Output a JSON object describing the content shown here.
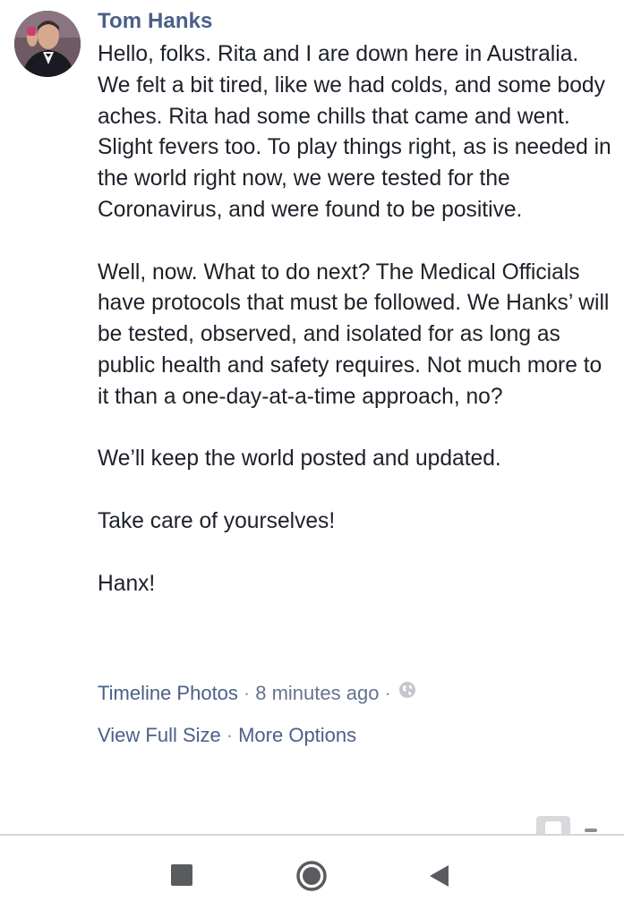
{
  "post": {
    "author": "Tom Hanks",
    "paragraphs": [
      "Hello, folks. Rita and I are down here in Australia. We felt a bit tired, like we had colds, and some body aches. Rita had some chills that came and went. Slight fevers too. To play things right, as is needed in the world right now, we were tested for the Coronavirus, and were found to be positive.",
      "Well, now. What to do next? The Medical Officials have protocols that must be followed. We Hanks’ will be tested, observed, and isolated for as long as public health and safety requires. Not much more to it than a one-day-at-a-time approach, no?",
      "We’ll keep the world posted and updated.",
      "Take care of yourselves!",
      "Hanx!"
    ],
    "album_link": "Timeline Photos",
    "timestamp": "8 minutes ago",
    "privacy_icon": "globe-icon",
    "view_full_size": "View Full Size",
    "more_options": "More Options",
    "separator": "·"
  },
  "navbar": {
    "recents_icon": "square-icon",
    "home_icon": "circle-home-icon",
    "back_icon": "triangle-back-icon"
  },
  "colors": {
    "author": "#4b5f88",
    "text": "#1d2129",
    "meta": "#65738f"
  }
}
